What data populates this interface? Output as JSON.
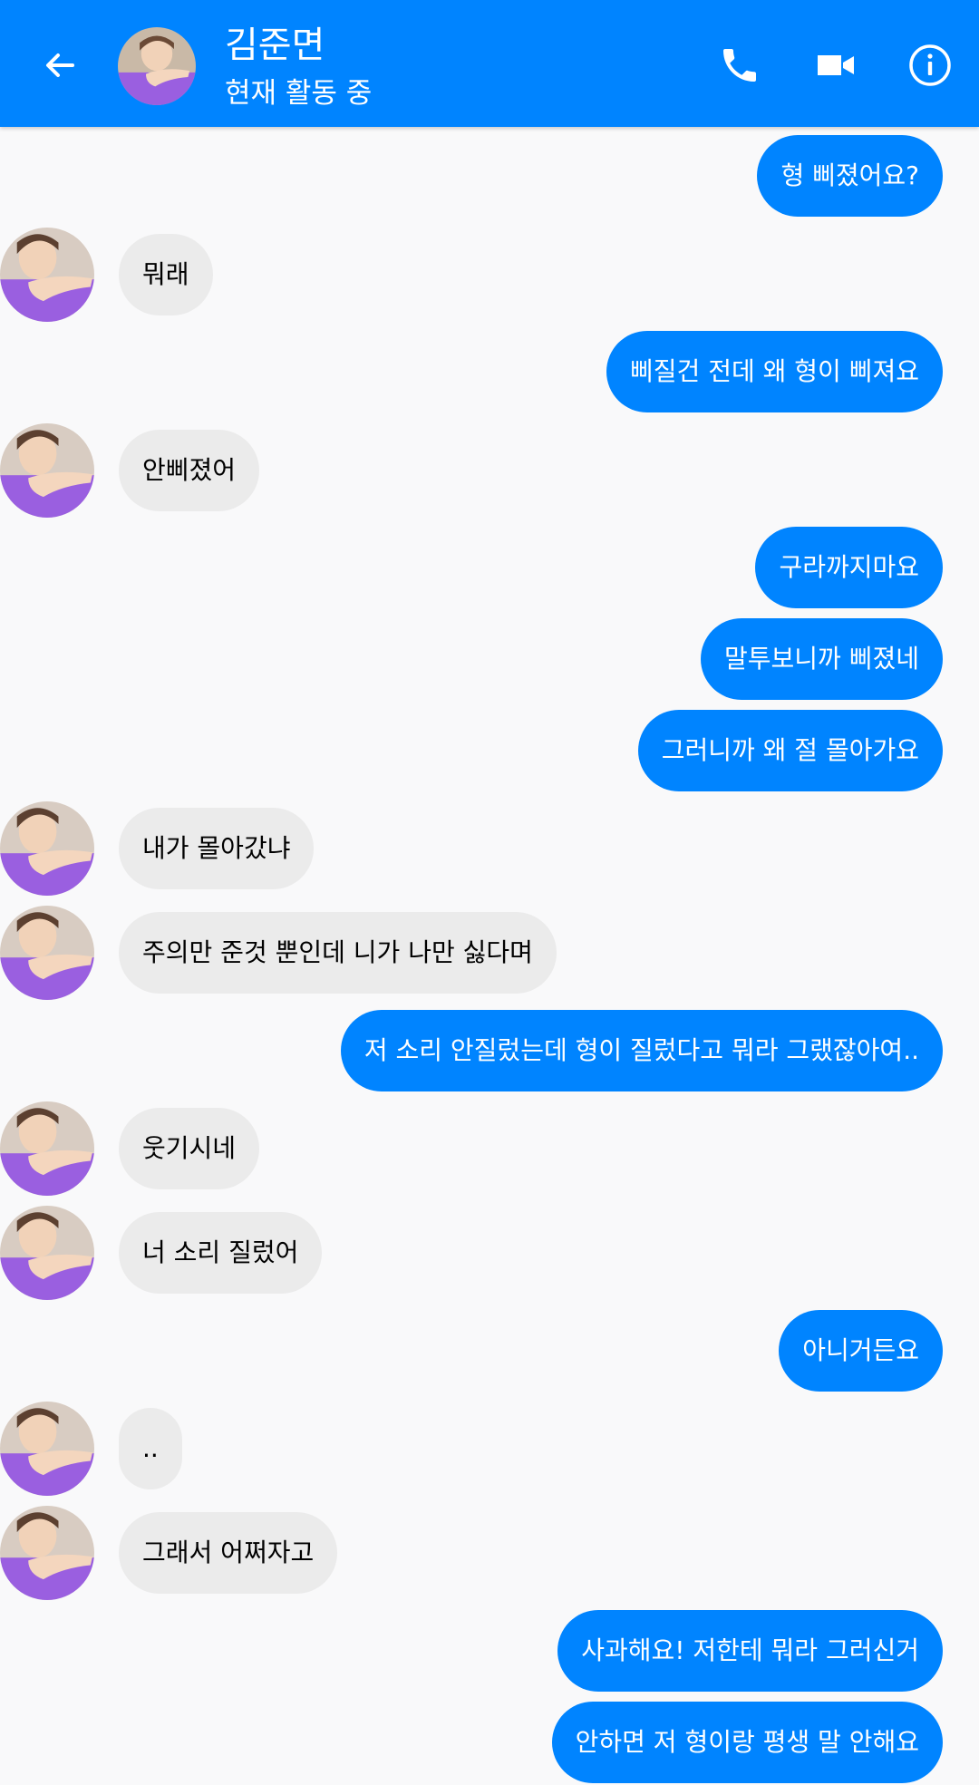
{
  "header": {
    "name": "김준면",
    "status": "현재 활동 중",
    "back_icon": "back-arrow-icon",
    "call_icon": "phone-icon",
    "video_icon": "video-camera-icon",
    "info_icon": "info-icon"
  },
  "colors": {
    "accent": "#0084ff",
    "incoming_bubble": "#ebebeb",
    "background": "#f9f9fa"
  },
  "messages": [
    {
      "from": "me",
      "text": "형 삐졌어요?"
    },
    {
      "from": "them",
      "text": "뭐래"
    },
    {
      "from": "me",
      "text": "삐질건 전데 왜 형이 삐져요"
    },
    {
      "from": "them",
      "text": "안삐졌어"
    },
    {
      "from": "me",
      "text": "구라까지마요"
    },
    {
      "from": "me",
      "text": "말투보니까 삐졌네"
    },
    {
      "from": "me",
      "text": "그러니까 왜 절 몰아가요"
    },
    {
      "from": "them",
      "text": "내가 몰아갔냐"
    },
    {
      "from": "them",
      "text": "주의만 준것 뿐인데 니가 나만 싫다며"
    },
    {
      "from": "me",
      "text": "저 소리 안질렀는데 형이 질렀다고 뭐라 그랬잖아여.."
    },
    {
      "from": "them",
      "text": "웃기시네"
    },
    {
      "from": "them",
      "text": "너 소리 질렀어"
    },
    {
      "from": "me",
      "text": "아니거든요"
    },
    {
      "from": "them",
      "text": ".."
    },
    {
      "from": "them",
      "text": "그래서 어쩌자고"
    },
    {
      "from": "me",
      "text": "사과해요! 저한테 뭐라 그러신거"
    },
    {
      "from": "me",
      "text": "안하면 저 형이랑 평생 말 안해요"
    }
  ]
}
